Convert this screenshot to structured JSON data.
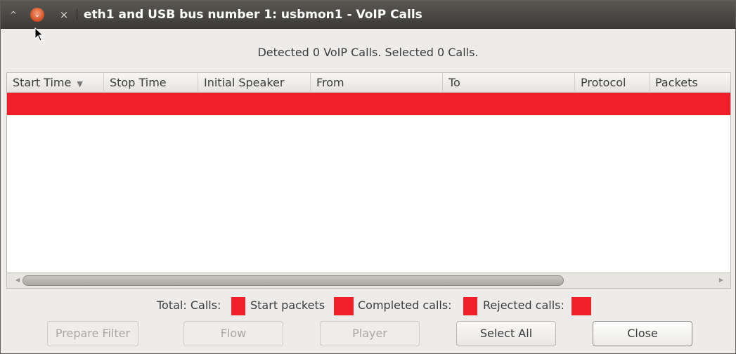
{
  "window": {
    "title": "eth1 and USB bus number 1: usbmon1 - VoIP Calls",
    "controls": [
      "^",
      "⌄",
      "×"
    ]
  },
  "summary": {
    "detected_text": "Detected 0 VoIP Calls. Selected 0 Calls."
  },
  "table": {
    "columns": [
      {
        "label": "Start Time",
        "sort": "▼"
      },
      {
        "label": "Stop Time"
      },
      {
        "label": "Initial Speaker"
      },
      {
        "label": "From"
      },
      {
        "label": "To"
      },
      {
        "label": "Protocol"
      },
      {
        "label": "Packets"
      }
    ],
    "rows": [],
    "selected_row_color": "#f0202a"
  },
  "stats": {
    "total_calls_label": "Total: Calls:",
    "start_packets_label": "Start packets",
    "completed_calls_label": "Completed calls:",
    "rejected_calls_label": "Rejected calls:"
  },
  "buttons": {
    "prepare_filter": "Prepare Filter",
    "flow": "Flow",
    "player": "Player",
    "select_all": "Select All",
    "close": "Close"
  },
  "colors": {
    "redaction": "#f0202a",
    "titlebar": "#3b3a36"
  }
}
